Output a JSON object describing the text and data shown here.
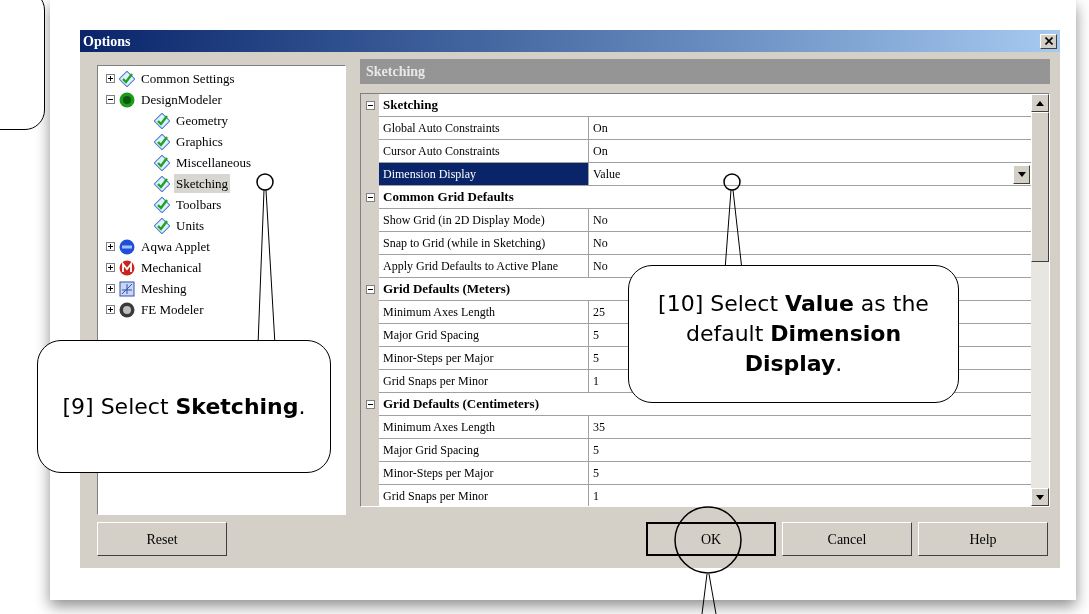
{
  "window": {
    "title": "Options"
  },
  "tree": [
    {
      "label": "Common Settings",
      "kind": "check",
      "expanded": false,
      "selected": false
    },
    {
      "label": "DesignModeler",
      "kind": "dm",
      "expanded": true,
      "selected": false,
      "children": [
        {
          "label": "Geometry",
          "kind": "check",
          "selected": false
        },
        {
          "label": "Graphics",
          "kind": "check",
          "selected": false
        },
        {
          "label": "Miscellaneous",
          "kind": "check",
          "selected": false
        },
        {
          "label": "Sketching",
          "kind": "check",
          "selected": true
        },
        {
          "label": "Toolbars",
          "kind": "check",
          "selected": false
        },
        {
          "label": "Units",
          "kind": "check",
          "selected": false
        }
      ]
    },
    {
      "label": "Aqwa Applet",
      "kind": "aqwa",
      "expanded": false,
      "selected": false
    },
    {
      "label": "Mechanical",
      "kind": "mech",
      "expanded": false,
      "selected": false
    },
    {
      "label": "Meshing",
      "kind": "mesh",
      "expanded": false,
      "selected": false
    },
    {
      "label": "FE Modeler",
      "kind": "fe",
      "expanded": false,
      "selected": false
    }
  ],
  "panel_title": "Sketching",
  "grid": [
    {
      "label": "Sketching",
      "expanded": true,
      "rows": [
        {
          "name": "Global Auto Constraints",
          "value": "On",
          "selected": false
        },
        {
          "name": "Cursor Auto Constraints",
          "value": "On",
          "selected": false
        },
        {
          "name": "Dimension Display",
          "value": "Value",
          "selected": true
        }
      ]
    },
    {
      "label": "Common Grid Defaults",
      "expanded": true,
      "rows": [
        {
          "name": "Show Grid (in 2D Display Mode)",
          "value": "No",
          "selected": false
        },
        {
          "name": "Snap to Grid (while in Sketching)",
          "value": "No",
          "selected": false
        },
        {
          "name": "Apply Grid Defaults to Active Plane",
          "value": "No",
          "selected": false
        }
      ]
    },
    {
      "label": "Grid Defaults (Meters)",
      "expanded": true,
      "rows": [
        {
          "name": "Minimum Axes Length",
          "value": "25",
          "selected": false
        },
        {
          "name": "Major Grid Spacing",
          "value": "5",
          "selected": false
        },
        {
          "name": "Minor-Steps per Major",
          "value": "5",
          "selected": false
        },
        {
          "name": "Grid Snaps per Minor",
          "value": "1",
          "selected": false
        }
      ]
    },
    {
      "label": "Grid Defaults (Centimeters)",
      "expanded": true,
      "rows": [
        {
          "name": "Minimum Axes Length",
          "value": "35",
          "selected": false
        },
        {
          "name": "Major Grid Spacing",
          "value": "5",
          "selected": false
        },
        {
          "name": "Minor-Steps per Major",
          "value": "5",
          "selected": false
        },
        {
          "name": "Grid Snaps per Minor",
          "value": "1",
          "selected": false
        }
      ]
    }
  ],
  "buttons": [
    {
      "label": "Reset",
      "focused": false
    },
    {
      "label": "OK",
      "focused": true
    },
    {
      "label": "Cancel",
      "focused": false
    },
    {
      "label": "Help",
      "focused": false
    }
  ],
  "callouts": [
    {
      "text": "[9] Select **Sketching**."
    },
    {
      "text": "[10] Select **Value** as the default **Dimension Display**."
    }
  ]
}
